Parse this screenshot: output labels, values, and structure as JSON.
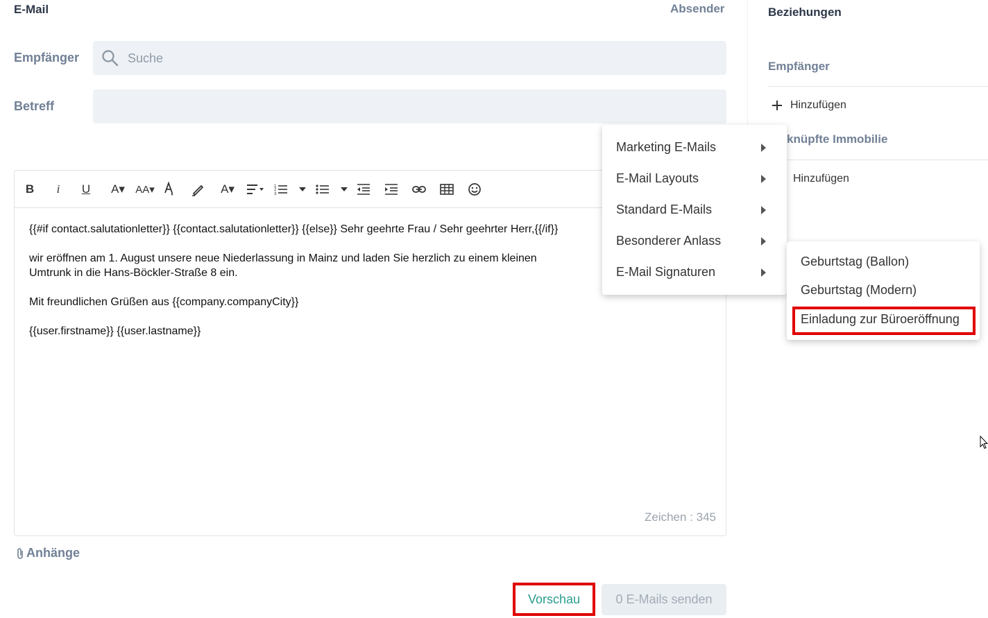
{
  "composer": {
    "title": "E-Mail",
    "sender_label": "Absender",
    "recipient_label": "Empfänger",
    "recipient_placeholder": "Suche",
    "subject_label": "Betreff",
    "subject_value": "",
    "attachments_label": "Anhänge",
    "preview_button": "Vorschau",
    "send_button": "0 E-Mails senden"
  },
  "toolbar": {
    "bold": "B",
    "italic": "i",
    "underline": "U",
    "font_size": "A▾",
    "font_family": "AA▾",
    "text_color": "A",
    "text_style": "A▾"
  },
  "editor": {
    "lines": [
      "{{#if contact.salutationletter}} {{contact.salutationletter}} {{else}} Sehr geehrte Frau / Sehr geehrter Herr,{{/if}}",
      "wir eröffnen am 1. August unsere neue Niederlassung in Mainz und laden Sie herzlich zu einem kleinen",
      "Umtrunk in die Hans-Böckler-Straße 8 ein.",
      "Mit freundlichen Grüßen aus {{company.companyCity}}",
      "{{user.firstname}} {{user.lastname}}"
    ],
    "char_counter": "Zeichen : 345"
  },
  "relations": {
    "title": "Beziehungen",
    "recipients_label": "Empfänger",
    "add_label": "Hinzufügen",
    "property_label": "knüpfte Immobilie",
    "add_label_2": "Hinzufügen"
  },
  "menu": {
    "items": [
      "Marketing E-Mails",
      "E-Mail Layouts",
      "Standard E-Mails",
      "Besonderer Anlass",
      "E-Mail Signaturen"
    ]
  },
  "submenu": {
    "items": [
      "Geburtstag (Ballon)",
      "Geburtstag (Modern)",
      "Einladung zur Büroeröffnung"
    ]
  },
  "colors": {
    "accent": "#2a9d8f",
    "highlight": "#e00000",
    "label": "#718096"
  }
}
